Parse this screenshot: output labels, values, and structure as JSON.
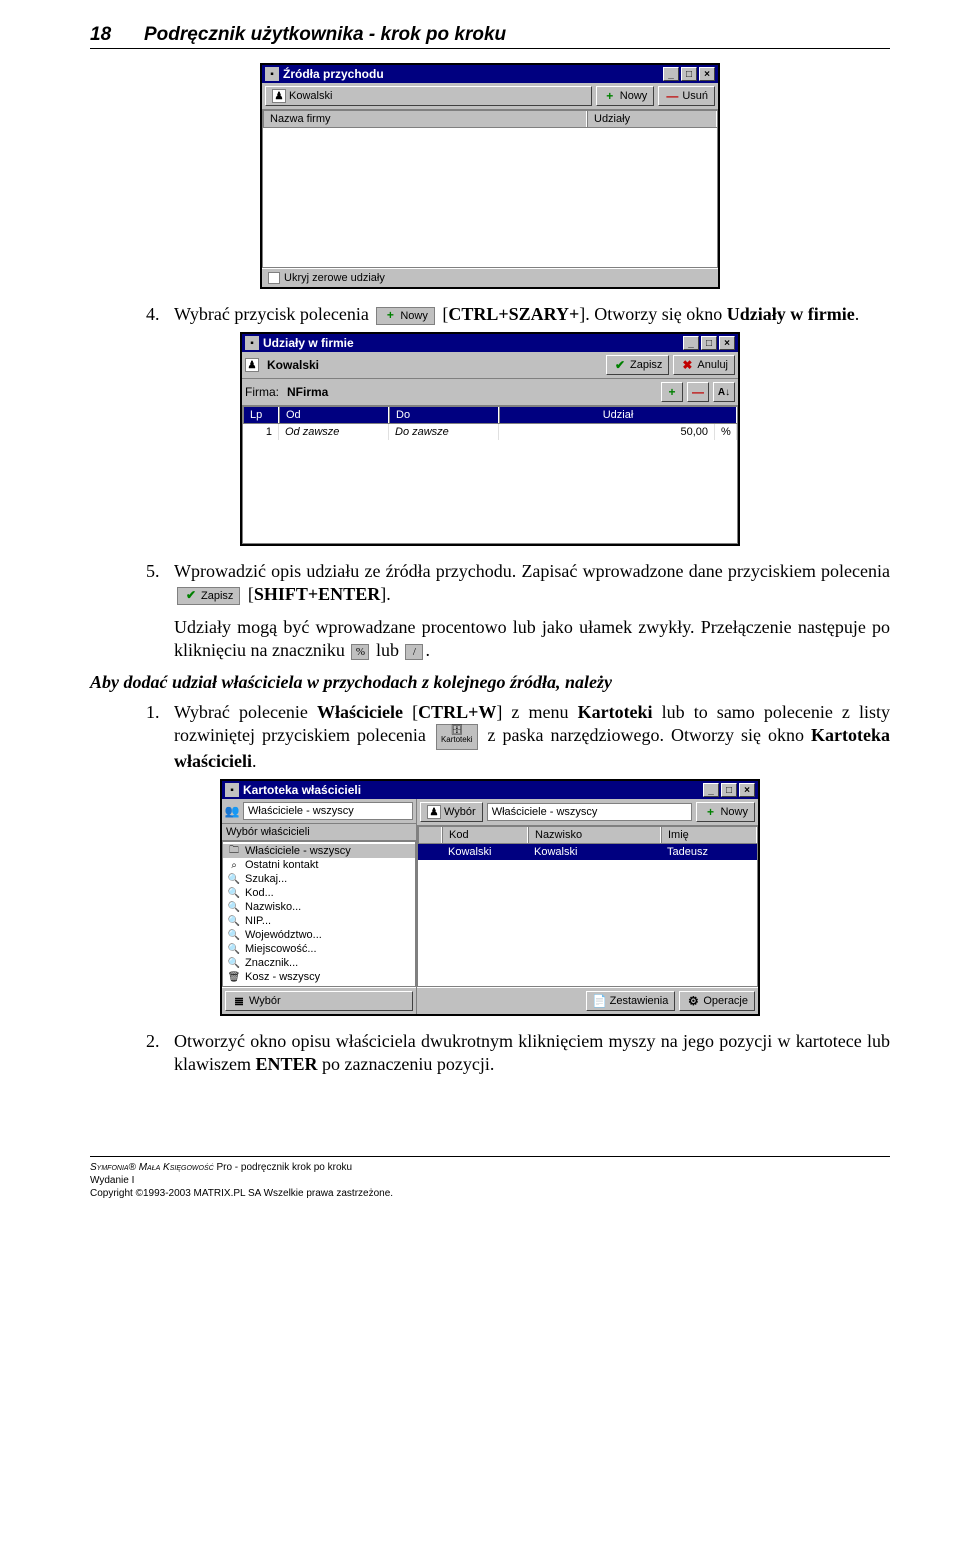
{
  "header": {
    "page_number": "18",
    "title": "Podręcznik użytkownika - krok po kroku"
  },
  "win1": {
    "title": "Źródła przychodu",
    "name_label": "Kowalski",
    "btn_new": "Nowy",
    "btn_del": "Usuń",
    "col_name": "Nazwa firmy",
    "col_shares": "Udziały",
    "chk_hide": "Ukryj zerowe udziały"
  },
  "step4": {
    "num": "4.",
    "pre": "Wybrać przycisk polecenia",
    "btn": "Nowy",
    "post1": " [",
    "key": "CTRL+SZARY+",
    "post2": "]. Otworzy się okno ",
    "winname": "Udziały w firmie",
    "post3": "."
  },
  "win2": {
    "title": "Udziały w firmie",
    "name_label": "Kowalski",
    "btn_save": "Zapisz",
    "btn_cancel": "Anuluj",
    "firma_label": "Firma:",
    "firma_value": "NFirma",
    "col_lp": "Lp",
    "col_od": "Od",
    "col_do": "Do",
    "col_udzial": "Udział",
    "row_lp": "1",
    "row_od": "Od zawsze",
    "row_do": "Do zawsze",
    "row_val": "50,00"
  },
  "step5": {
    "num": "5.",
    "pre": "Wprowadzić opis udziału ze źródła przychodu. Zapisać wprowadzone dane przyciskiem polecenia",
    "btn": "Zapisz",
    "post1": " [",
    "key": "SHIFT+ENTER",
    "post2": "]."
  },
  "note": {
    "t1": "Udziały mogą być wprowadzane procentowo lub jako ułamek zwykły. Przełączenie następuje po kliknięciu na znaczniku",
    "t2": "lub",
    "t3": "."
  },
  "subhead": "Aby dodać udział właściciela w przychodach z kolejnego źródła, należy",
  "step1b": {
    "num": "1.",
    "pre": "Wybrać polecenie ",
    "owners": "Właściciele",
    "mid1": " [",
    "key": "CTRL+W",
    "mid2": "] z menu ",
    "menu": "Kartoteki",
    "mid3": " lub to samo polecenie z listy rozwiniętej przyciskiem polecenia",
    "btn": "Kartoteki",
    "mid4": " z paska narzędziowego. Otworzy się okno ",
    "winname": "Kartoteka właścicieli",
    "post": "."
  },
  "win3": {
    "title": "Kartoteka właścicieli",
    "left_head": "Właściciele - wszyscy",
    "left_label": "Wybór właścicieli",
    "tree": [
      "Właściciele - wszyscy",
      "Ostatni kontakt",
      "Szukaj...",
      "Kod...",
      "Nazwisko...",
      "NIP...",
      "Województwo...",
      "Miejscowość...",
      "Znacznik...",
      "Kosz - wszyscy"
    ],
    "btn_wybor": "Wybór",
    "right_head_wybor": "Wybór",
    "right_head_group": "Właściciele - wszyscy",
    "btn_nowy": "Nowy",
    "col_blank": "",
    "col_kod": "Kod",
    "col_nazw": "Nazwisko",
    "col_imie": "Imię",
    "row_kod": "Kowalski",
    "row_nazw": "Kowalski",
    "row_imie": "Tadeusz",
    "btn_zest": "Zestawienia",
    "btn_oper": "Operacje"
  },
  "step2b": {
    "num": "2.",
    "txt": "Otworzyć okno opisu właściciela dwukrotnym kliknięciem myszy na jego pozycji w kartotece lub klawiszem ",
    "key": "ENTER",
    "post": " po zaznaczeniu pozycji."
  },
  "footer": {
    "line1_a": "Symfonia",
    "line1_b": "® ",
    "line1_c": "Mała Księgowość",
    "line1_d": " Pro - podręcznik krok po kroku",
    "line2": "Wydanie I",
    "line3": "Copyright ©1993-2003 MATRIX.PL SA Wszelkie prawa zastrzeżone."
  }
}
